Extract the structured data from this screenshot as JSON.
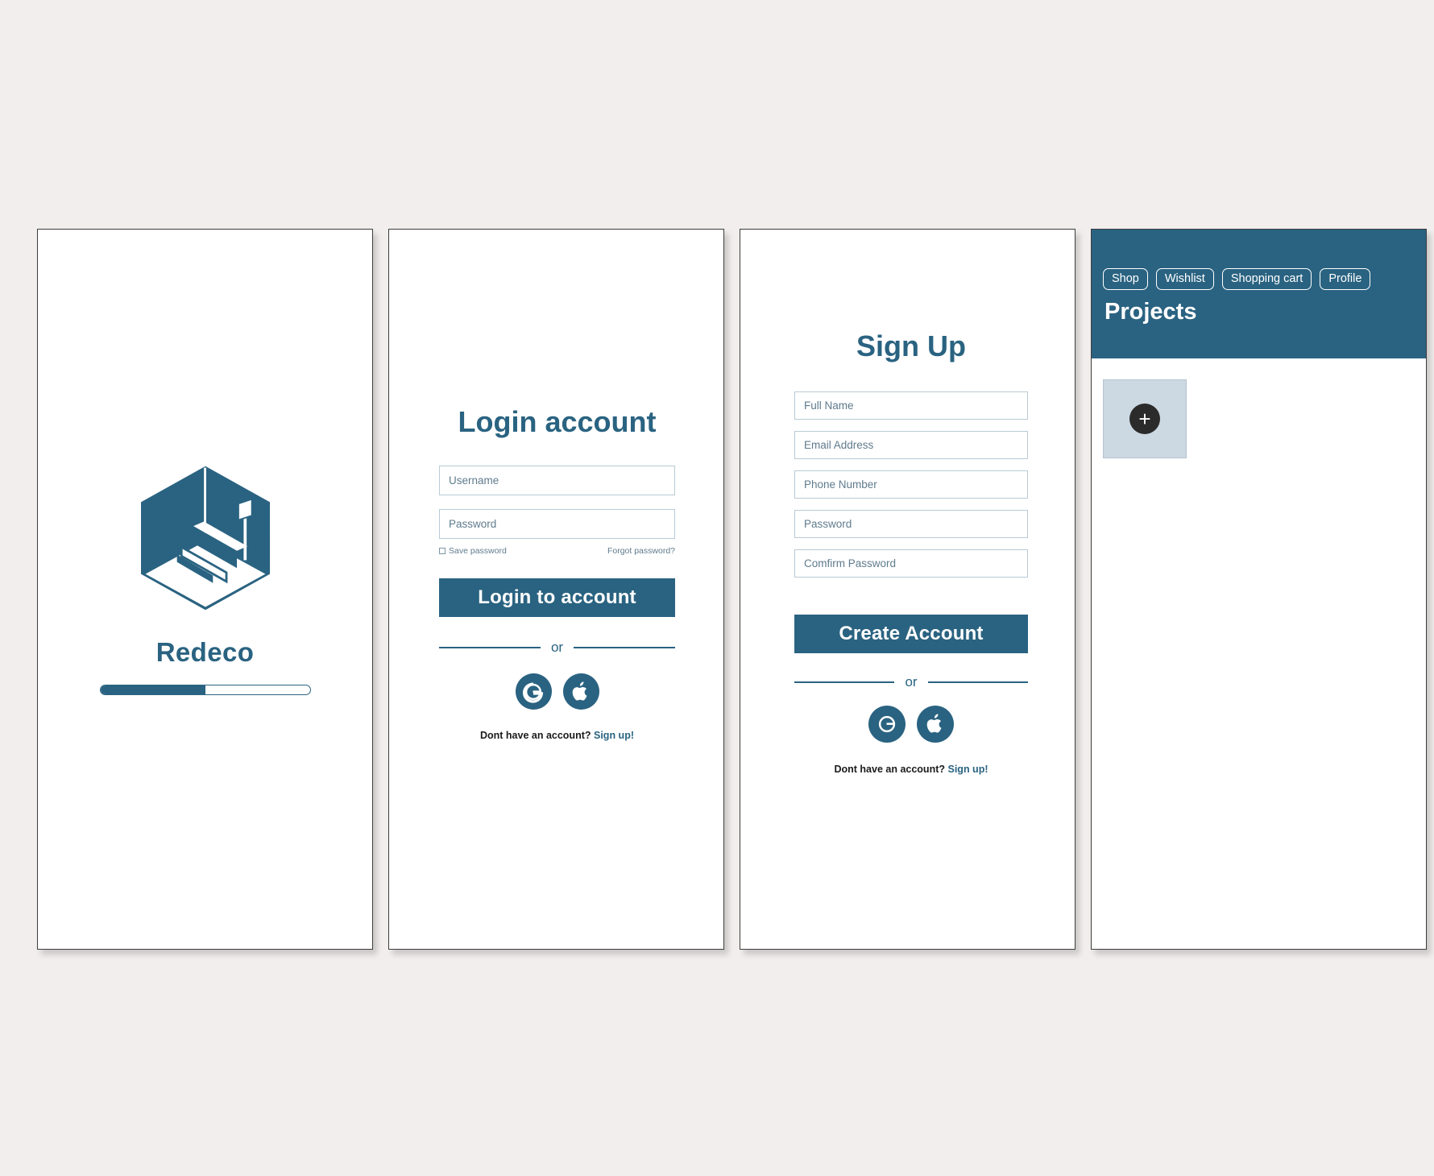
{
  "brand": {
    "accent_color": "#2a6381",
    "canvas_color": "#f2eeee"
  },
  "splash": {
    "logo_icon": "isometric-room-logo",
    "app_name": "Redeco",
    "progress_percent": 50
  },
  "login": {
    "title": "Login account",
    "fields": [
      {
        "name": "username",
        "placeholder": "Username",
        "value": ""
      },
      {
        "name": "password",
        "placeholder": "Password",
        "value": ""
      }
    ],
    "save_password_label": "Save password",
    "save_password_checked": false,
    "forgot_password_label": "Forgot password?",
    "submit_label": "Login to account",
    "divider_label": "or",
    "social": [
      {
        "name": "google-login-button",
        "glyph": "G"
      },
      {
        "name": "apple-login-button",
        "glyph": "apple"
      }
    ],
    "footer_text": "Dont have an account?",
    "footer_link": "Sign up!"
  },
  "signup": {
    "title": "Sign Up",
    "fields": [
      {
        "name": "full-name",
        "placeholder": "Full Name",
        "value": ""
      },
      {
        "name": "email-address",
        "placeholder": "Email Address",
        "value": ""
      },
      {
        "name": "phone-number",
        "placeholder": "Phone Number",
        "value": ""
      },
      {
        "name": "password",
        "placeholder": "Password",
        "value": ""
      },
      {
        "name": "confirm-password",
        "placeholder": "Comfirm Password",
        "value": ""
      }
    ],
    "submit_label": "Create Account",
    "divider_label": "or",
    "social": [
      {
        "name": "google-signup-button",
        "glyph": "G"
      },
      {
        "name": "apple-signup-button",
        "glyph": "apple"
      }
    ],
    "footer_text": "Dont have an account?",
    "footer_link": "Sign up!"
  },
  "projects": {
    "nav": [
      {
        "label": "Shop"
      },
      {
        "label": "Wishlist"
      },
      {
        "label": "Shopping cart"
      },
      {
        "label": "Profile"
      }
    ],
    "title": "Projects",
    "add_card": {
      "icon": "plus-icon",
      "glyph": "+"
    }
  }
}
